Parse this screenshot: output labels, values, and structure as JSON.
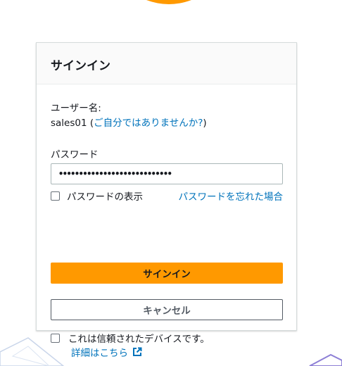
{
  "signin": {
    "title": "サインイン",
    "username_label": "ユーザー名:",
    "username_value": "sales01",
    "not_you_open": " (",
    "not_you_link": "ご自分ではありませんか?",
    "not_you_close": ")",
    "password_label": "パスワード",
    "password_value": "••••••••••••••••••••••••••••",
    "show_password_label": "パスワードの表示",
    "forgot_password_link": "パスワードを忘れた場合",
    "signin_button": "サインイン",
    "cancel_button": "キャンセル",
    "trusted_device_label": "これは信頼されたデバイスです。",
    "details_link": "詳細はこちら"
  },
  "colors": {
    "primary": "#ff9900",
    "link": "#0073bb",
    "text": "#16191f"
  },
  "icons": {
    "external_link": "external-link-icon"
  }
}
